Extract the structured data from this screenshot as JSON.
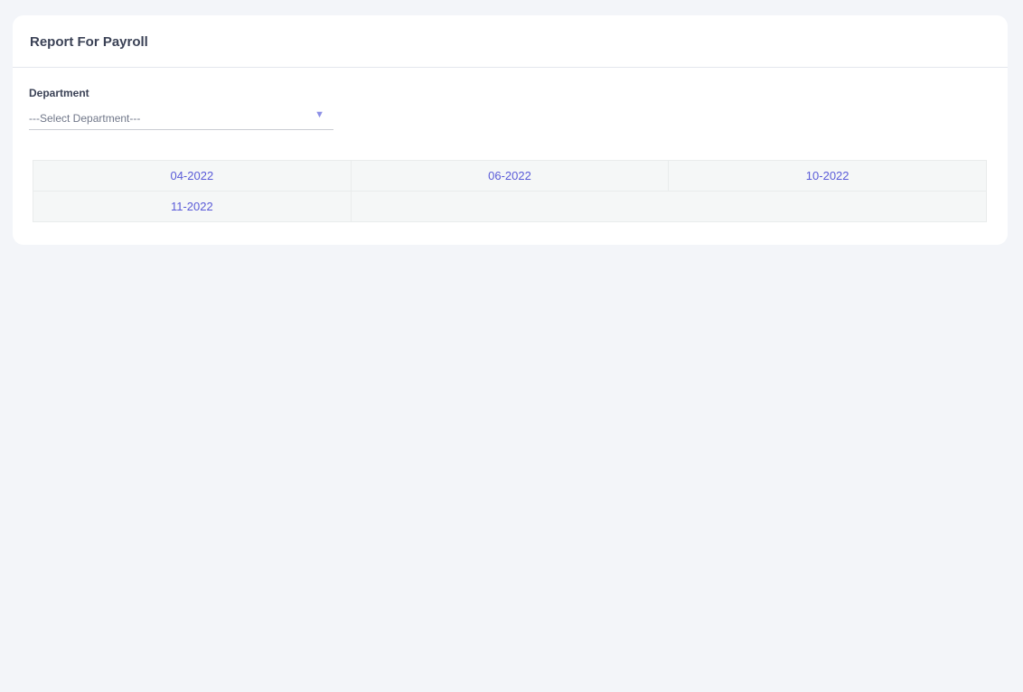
{
  "page": {
    "title": "Report For Payroll"
  },
  "filters": {
    "department_label": "Department",
    "department_selected": "---Select Department---"
  },
  "months": [
    [
      "04-2022",
      "06-2022",
      "10-2022"
    ],
    [
      "11-2022",
      "",
      ""
    ]
  ],
  "colors": {
    "background": "#f3f5f9",
    "card": "#ffffff",
    "link": "#5a5bd8",
    "title": "#3b4256",
    "arrow": "#8c8fe6"
  },
  "icons": {
    "select_arrow": "dropdown-arrow-icon"
  }
}
